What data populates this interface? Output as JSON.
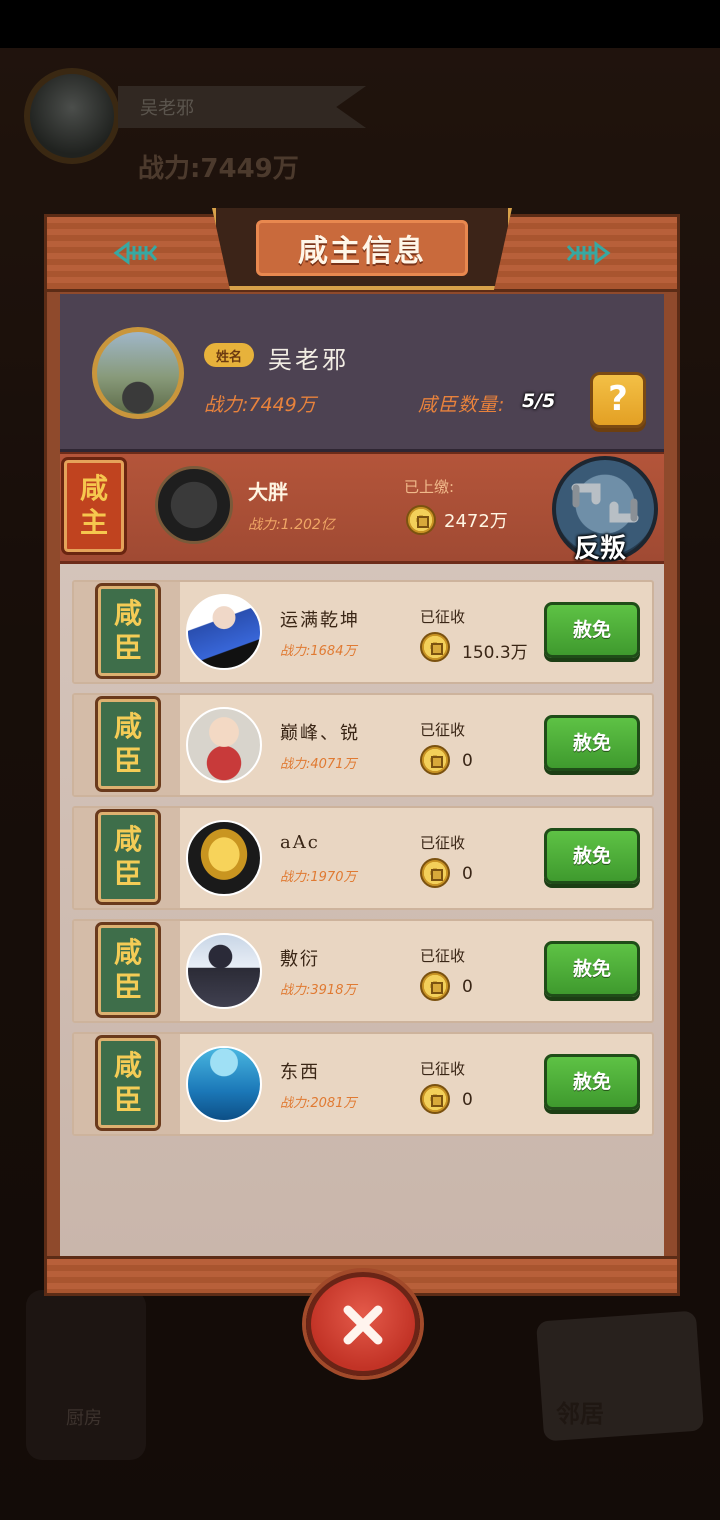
{
  "background": {
    "player_name": "吴老邪",
    "player_power": "战力:7449万",
    "kitchen_label": "厨房",
    "neighbor_label": "邻居"
  },
  "dialog": {
    "title": "咸主信息",
    "owner": {
      "name_tag": "姓名",
      "name": "吴老邪",
      "power": "战力:7449万",
      "vassal_count_label": "咸臣数量:",
      "vassal_count": "5/5",
      "help_label": "?"
    },
    "master": {
      "role": [
        "咸",
        "主"
      ],
      "name": "大胖",
      "power": "战力:1.202亿",
      "paid_label": "已上缴:",
      "paid_value": "2472万",
      "rebel_label": "反叛"
    },
    "vassals": [
      {
        "role": [
          "咸",
          "臣"
        ],
        "name": "运满乾坤",
        "power": "战力:1684万",
        "tax_label": "已征收",
        "tax": "150.3万",
        "action": "赦免"
      },
      {
        "role": [
          "咸",
          "臣"
        ],
        "name": "巅峰、锐",
        "power": "战力:4071万",
        "tax_label": "已征收",
        "tax": "0",
        "action": "赦免"
      },
      {
        "role": [
          "咸",
          "臣"
        ],
        "name": "aAc",
        "power": "战力:1970万",
        "tax_label": "已征收",
        "tax": "0",
        "action": "赦免"
      },
      {
        "role": [
          "咸",
          "臣"
        ],
        "name": "敷衍",
        "power": "战力:3918万",
        "tax_label": "已征收",
        "tax": "0",
        "action": "赦免"
      },
      {
        "role": [
          "咸",
          "臣"
        ],
        "name": "东西",
        "power": "战力:2081万",
        "tax_label": "已征收",
        "tax": "0",
        "action": "赦免"
      }
    ],
    "close_icon": "close-icon"
  },
  "colors": {
    "frame": "#8f4a2c",
    "panel": "#4d4252",
    "accent_orange": "#e8823c",
    "button_green": "#4fb03a",
    "close_red": "#d2402f"
  }
}
